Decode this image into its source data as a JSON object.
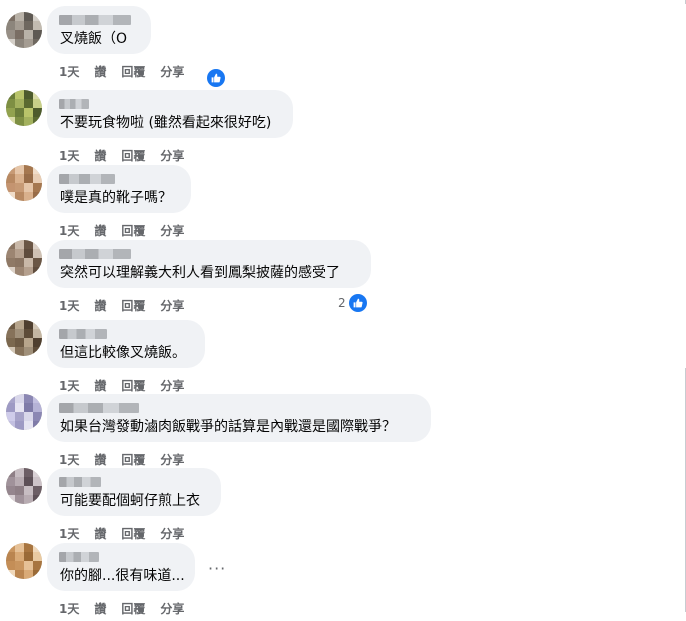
{
  "comments": [
    {
      "text": "叉燒飯（O",
      "time": "1天",
      "like": "讚",
      "reply": "回覆",
      "share": "分享",
      "reactions": "",
      "avatar_colors": [
        "#7a6e64",
        "#b9b2a8",
        "#5e5953",
        "#d4cfc8",
        "#8c857c",
        "#a49c92",
        "#6e675f",
        "#c2bbb1",
        "#978f86"
      ]
    },
    {
      "text": "不要玩食物啦 (雖然看起來很好吃)",
      "time": "1天",
      "like": "讚",
      "reply": "回覆",
      "share": "分享",
      "reactions": "",
      "avatar_colors": [
        "#6b7d3a",
        "#b9c46a",
        "#4d5b2c",
        "#d9dba7",
        "#7e8f43",
        "#a3b15e",
        "#5a6a30",
        "#c8d089",
        "#92a24f"
      ]
    },
    {
      "text": "噗是真的靴子嗎？",
      "time": "1天",
      "like": "讚",
      "reply": "回覆",
      "share": "分享",
      "reactions": "",
      "avatar_colors": [
        "#c79a75",
        "#e5c5a8",
        "#a5774f",
        "#f0dcc8",
        "#b88962",
        "#d9b08c",
        "#986c48",
        "#e8cdb4",
        "#c49470"
      ]
    },
    {
      "text": "突然可以理解義大利人看到鳳梨披薩的感受了",
      "time": "1天",
      "like": "讚",
      "reply": "回覆",
      "share": "分享",
      "reactions": "2",
      "avatar_colors": [
        "#8a7462",
        "#c9b8a8",
        "#6a5645",
        "#dcd1c7",
        "#9c8572",
        "#b5a08e",
        "#5f4c3d",
        "#cfc1b4",
        "#8f7966"
      ]
    },
    {
      "text": "但這比較像叉燒飯。",
      "time": "1天",
      "like": "讚",
      "reply": "回覆",
      "share": "分享",
      "reactions": "",
      "avatar_colors": [
        "#6d5a44",
        "#b7a58c",
        "#4f3f2f",
        "#d2c6b5",
        "#86725a",
        "#a0907a",
        "#5e4c38",
        "#c4b6a2",
        "#7b684f"
      ]
    },
    {
      "text": "如果台灣發動滷肉飯戰爭的話算是內戰還是國際戰爭？",
      "time": "1天",
      "like": "讚",
      "reply": "回覆",
      "share": "分享",
      "reactions": "",
      "avatar_colors": [
        "#a7a3c9",
        "#d9d7ea",
        "#8b87b3",
        "#c2bfe0",
        "#9e9ac4",
        "#e6e4f2",
        "#7f7ba8",
        "#b5b2d6",
        "#cfccea"
      ]
    },
    {
      "text": "可能要配個蚵仔煎上衣",
      "time": "1天",
      "like": "讚",
      "reply": "回覆",
      "share": "分享",
      "reactions": "",
      "avatar_colors": [
        "#8e7f86",
        "#c7bdc2",
        "#6c5e65",
        "#d9d1d5",
        "#a0929a",
        "#b8acb2",
        "#5d5057",
        "#cdc3c8",
        "#95868e"
      ]
    },
    {
      "text": "你的腳...很有味道...",
      "time": "1天",
      "like": "讚",
      "reply": "回覆",
      "share": "分享",
      "reactions": "",
      "avatar_colors": [
        "#c9955f",
        "#e6c197",
        "#a87540",
        "#f0d8ba",
        "#ba8550",
        "#d9aa77",
        "#9a6a37",
        "#e9caa2",
        "#c48e57"
      ]
    }
  ],
  "more_label": "···"
}
